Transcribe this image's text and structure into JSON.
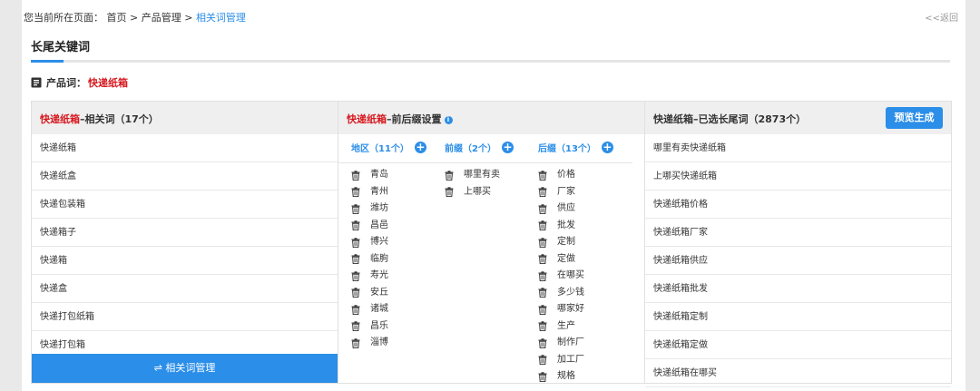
{
  "breadcrumb": {
    "prefix": "您当前所在页面：",
    "home": "首页",
    "sep": ">",
    "section": "产品管理",
    "current": "相关词管理"
  },
  "back_link": "<<返回",
  "page_title": "长尾关键词",
  "product": {
    "label": "产品词：",
    "value": "快递纸箱"
  },
  "related": {
    "title_red": "快递纸箱",
    "title_rest": "–相关词（17个）",
    "items": [
      "快递纸箱",
      "快递纸盒",
      "快递包装箱",
      "快递箱子",
      "快递箱",
      "快递盒",
      "快递打包纸箱",
      "快递打包箱"
    ],
    "manage_button": "⇌ 相关词管理"
  },
  "affix": {
    "title_red": "快递纸箱",
    "title_rest": "–前后缀设置",
    "info_icon": "info-icon",
    "region": {
      "label": "地区（11个）",
      "items": [
        "青岛",
        "青州",
        "潍坊",
        "昌邑",
        "博兴",
        "临朐",
        "寿光",
        "安丘",
        "诸城",
        "昌乐",
        "淄博"
      ]
    },
    "prefix": {
      "label": "前缀（2个）",
      "items": [
        "哪里有卖",
        "上哪买"
      ]
    },
    "suffix": {
      "label": "后缀（13个）",
      "items": [
        "价格",
        "厂家",
        "供应",
        "批发",
        "定制",
        "定做",
        "在哪买",
        "多少钱",
        "哪家好",
        "生产",
        "制作厂",
        "加工厂",
        "规格"
      ]
    }
  },
  "longtail": {
    "title": "快递纸箱–已选长尾词（2873个）",
    "preview_button": "预览生成",
    "items": [
      "哪里有卖快递纸箱",
      "上哪买快递纸箱",
      "快递纸箱价格",
      "快递纸箱厂家",
      "快递纸箱供应",
      "快递纸箱批发",
      "快递纸箱定制",
      "快递纸箱定做",
      "快递纸箱在哪买"
    ]
  },
  "colors": {
    "accent": "#2b8ee8",
    "red": "#d6181e"
  }
}
